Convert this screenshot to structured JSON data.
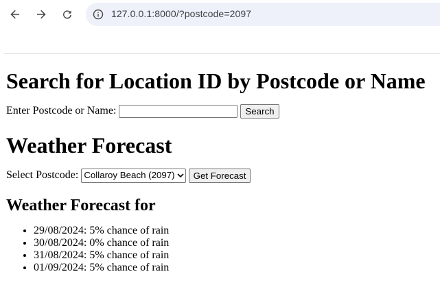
{
  "browser": {
    "url": "127.0.0.1:8000/?postcode=2097"
  },
  "search": {
    "heading": "Search for Location ID by Postcode or Name",
    "label": "Enter Postcode or Name:",
    "input_value": "",
    "button_label": "Search"
  },
  "forecast": {
    "heading": "Weather Forecast",
    "select_label": "Select Postcode:",
    "selected_option": "Collaroy Beach (2097)",
    "button_label": "Get Forecast"
  },
  "results": {
    "heading": "Weather Forecast for",
    "items": [
      "29/08/2024: 5% chance of rain",
      "30/08/2024: 0% chance of rain",
      "31/08/2024: 5% chance of rain",
      "01/09/2024: 5% chance of rain"
    ]
  }
}
